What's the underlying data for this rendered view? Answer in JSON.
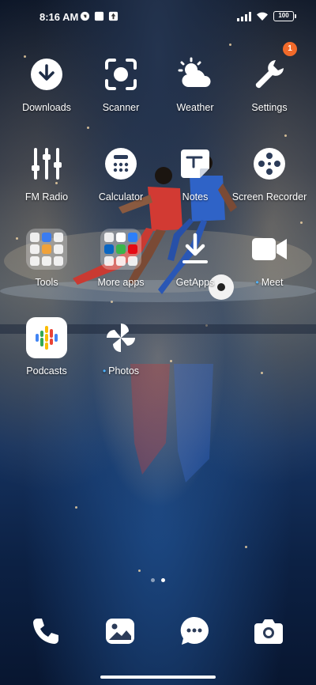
{
  "status_bar": {
    "time": "8:16 AM",
    "battery": "100"
  },
  "apps": [
    {
      "label": "Downloads",
      "icon": "download-icon"
    },
    {
      "label": "Scanner",
      "icon": "scanner-icon"
    },
    {
      "label": "Weather",
      "icon": "weather-icon"
    },
    {
      "label": "Settings",
      "icon": "wrench-icon",
      "badge": "1"
    },
    {
      "label": "FM Radio",
      "icon": "equalizer-icon"
    },
    {
      "label": "Calculator",
      "icon": "calculator-icon"
    },
    {
      "label": "Notes",
      "icon": "notes-icon"
    },
    {
      "label": "Screen Recorder",
      "icon": "film-reel-icon"
    },
    {
      "label": "Tools",
      "icon": "folder-icon"
    },
    {
      "label": "More apps",
      "icon": "folder-icon"
    },
    {
      "label": "GetApps",
      "icon": "getapps-download-icon"
    },
    {
      "label": "Meet",
      "icon": "video-camera-icon"
    },
    {
      "label": "Podcasts",
      "icon": "podcasts-icon"
    },
    {
      "label": "Photos",
      "icon": "pinwheel-icon"
    }
  ],
  "dock": [
    {
      "name": "Phone",
      "icon": "phone-icon"
    },
    {
      "name": "Gallery",
      "icon": "gallery-icon"
    },
    {
      "name": "Messages",
      "icon": "chat-bubble-icon"
    },
    {
      "name": "Camera",
      "icon": "camera-icon"
    }
  ],
  "colors": {
    "badge": "#f26a2a",
    "new_app_dot": "#4fb3ff"
  }
}
